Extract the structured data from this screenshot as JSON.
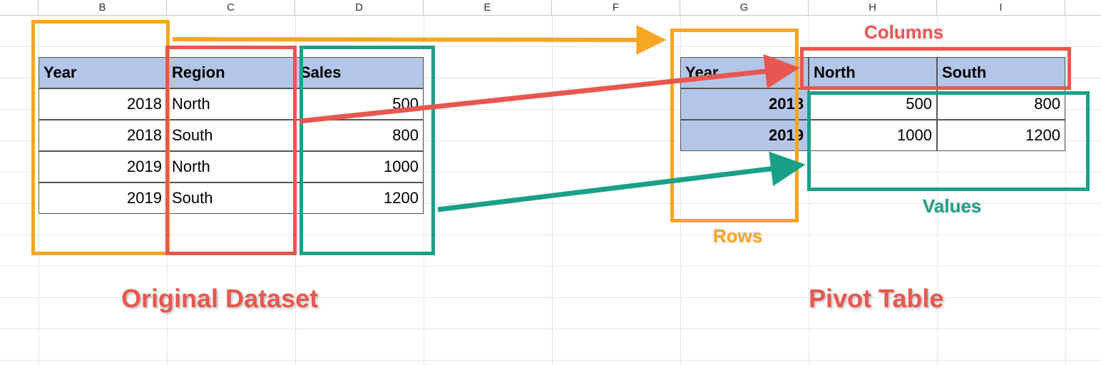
{
  "columns": [
    "B",
    "C",
    "D",
    "E",
    "F",
    "G",
    "H",
    "I"
  ],
  "original": {
    "headers": {
      "year": "Year",
      "region": "Region",
      "sales": "Sales"
    },
    "rows": [
      {
        "year": "2018",
        "region": "North",
        "sales": "500"
      },
      {
        "year": "2018",
        "region": "South",
        "sales": "800"
      },
      {
        "year": "2019",
        "region": "North",
        "sales": "1000"
      },
      {
        "year": "2019",
        "region": "South",
        "sales": "1200"
      }
    ]
  },
  "pivot": {
    "corner": "Year",
    "col_headers": [
      "North",
      "South"
    ],
    "row_headers": [
      "2018",
      "2019"
    ],
    "values": [
      [
        "500",
        "800"
      ],
      [
        "1000",
        "1200"
      ]
    ]
  },
  "labels": {
    "left": "Original Dataset",
    "right": "Pivot Table",
    "rows": "Rows",
    "columns": "Columns",
    "values": "Values"
  }
}
